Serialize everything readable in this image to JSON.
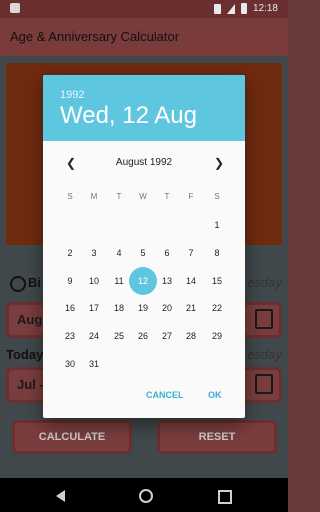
{
  "status_bar": {
    "time": "12:18"
  },
  "app": {
    "title": "Age & Anniversary Calculator"
  },
  "background": {
    "birth_label": "Bi",
    "birth_day_suffix": "esday",
    "birth_field": "Aug",
    "today_label": "Today",
    "today_day_suffix": "esday",
    "today_field": "Jul -",
    "calculate_label": "CALCULATE",
    "reset_label": "RESET"
  },
  "dialog": {
    "year": "1992",
    "selected_date": "Wed, 12 Aug",
    "month_label": "August 1992",
    "weekdays": [
      "S",
      "M",
      "T",
      "W",
      "T",
      "F",
      "S"
    ],
    "weeks": [
      [
        "",
        "",
        "",
        "",
        "",
        "",
        "1"
      ],
      [
        "2",
        "3",
        "4",
        "5",
        "6",
        "7",
        "8"
      ],
      [
        "9",
        "10",
        "11",
        "12",
        "13",
        "14",
        "15"
      ],
      [
        "16",
        "17",
        "18",
        "19",
        "20",
        "21",
        "22"
      ],
      [
        "23",
        "24",
        "25",
        "26",
        "27",
        "28",
        "29"
      ],
      [
        "30",
        "31",
        "",
        "",
        "",
        "",
        ""
      ]
    ],
    "selected_day": "12",
    "cancel_label": "CANCEL",
    "ok_label": "OK"
  },
  "colors": {
    "accent": "#5ec7df",
    "app_bar": "#7a3b3b",
    "status_bar": "#6a2f2f"
  }
}
